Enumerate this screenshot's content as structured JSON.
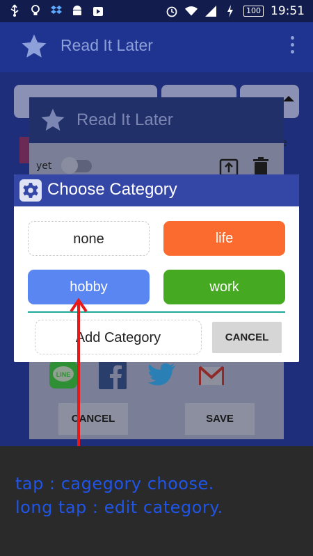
{
  "statusbar": {
    "time": "19:51",
    "battery": "100",
    "icons_left": [
      "usb-icon",
      "bulb-icon",
      "dropbox-icon",
      "android-icon",
      "play-store-icon"
    ],
    "icons_right": [
      "alarm-icon",
      "wifi-icon",
      "signal-icon",
      "charging-icon"
    ]
  },
  "appbar": {
    "title": "Read It Later",
    "icon": "star-icon"
  },
  "background_dialog": {
    "title": "Read It Later",
    "toggle_label": "yet",
    "side_text": "ne",
    "share_apps": [
      "LINE",
      "facebook",
      "twitter",
      "gmail"
    ],
    "cancel_label": "CANCEL",
    "save_label": "SAVE"
  },
  "dialog": {
    "title": "Choose Category",
    "categories": [
      {
        "label": "none",
        "color": "#ffffff"
      },
      {
        "label": "life",
        "color": "#fb6a2e"
      },
      {
        "label": "hobby",
        "color": "#5a86f2"
      },
      {
        "label": "work",
        "color": "#45a922"
      }
    ],
    "add_label": "Add Category",
    "cancel_label": "CANCEL"
  },
  "annotation": {
    "line1": "tap : cagegory choose.",
    "line2": "long tap : edit category.",
    "arrow_color": "#e81818"
  }
}
